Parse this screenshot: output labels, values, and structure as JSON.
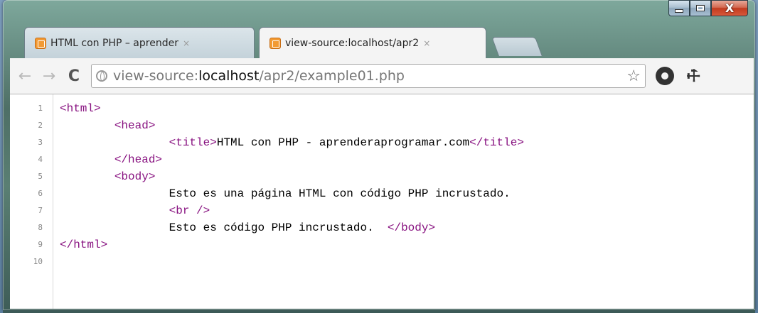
{
  "window": {
    "controls": {
      "minimize": "minimize-icon",
      "maximize": "maximize-icon",
      "close": "close-icon"
    },
    "close_glyph": "X"
  },
  "tabs": [
    {
      "title": "HTML con PHP – aprender",
      "close": "×",
      "active": false
    },
    {
      "title": "view-source:localhost/apr2",
      "close": "×",
      "active": true
    }
  ],
  "toolbar": {
    "back": "←",
    "forward": "→",
    "reload": "C",
    "url_prefix": "view-source:",
    "url_host": "localhost",
    "url_path": "/apr2/example01.php",
    "star": "☆",
    "wrench": "🔧"
  },
  "source": {
    "lines": [
      {
        "n": "1",
        "indent": "",
        "parts": [
          {
            "t": "<html>",
            "tag": true
          }
        ]
      },
      {
        "n": "2",
        "indent": "        ",
        "parts": [
          {
            "t": "<head>",
            "tag": true
          }
        ]
      },
      {
        "n": "3",
        "indent": "                ",
        "parts": [
          {
            "t": "<title>",
            "tag": true
          },
          {
            "t": "HTML con PHP - aprenderaprogramar.com",
            "tag": false
          },
          {
            "t": "</title>",
            "tag": true
          }
        ]
      },
      {
        "n": "4",
        "indent": "        ",
        "parts": [
          {
            "t": "</head>",
            "tag": true
          }
        ]
      },
      {
        "n": "5",
        "indent": "        ",
        "parts": [
          {
            "t": "<body>",
            "tag": true
          }
        ]
      },
      {
        "n": "6",
        "indent": "                ",
        "parts": [
          {
            "t": "Esto es una página HTML con código PHP incrustado.",
            "tag": false
          }
        ]
      },
      {
        "n": "7",
        "indent": "                ",
        "parts": [
          {
            "t": "<br />",
            "tag": true
          }
        ]
      },
      {
        "n": "8",
        "indent": "                ",
        "parts": [
          {
            "t": "Esto es código PHP incrustado.  ",
            "tag": false
          },
          {
            "t": "</body>",
            "tag": true
          }
        ]
      },
      {
        "n": "9",
        "indent": "",
        "parts": [
          {
            "t": "</html>",
            "tag": true
          }
        ]
      },
      {
        "n": "10",
        "indent": "",
        "parts": []
      }
    ]
  }
}
